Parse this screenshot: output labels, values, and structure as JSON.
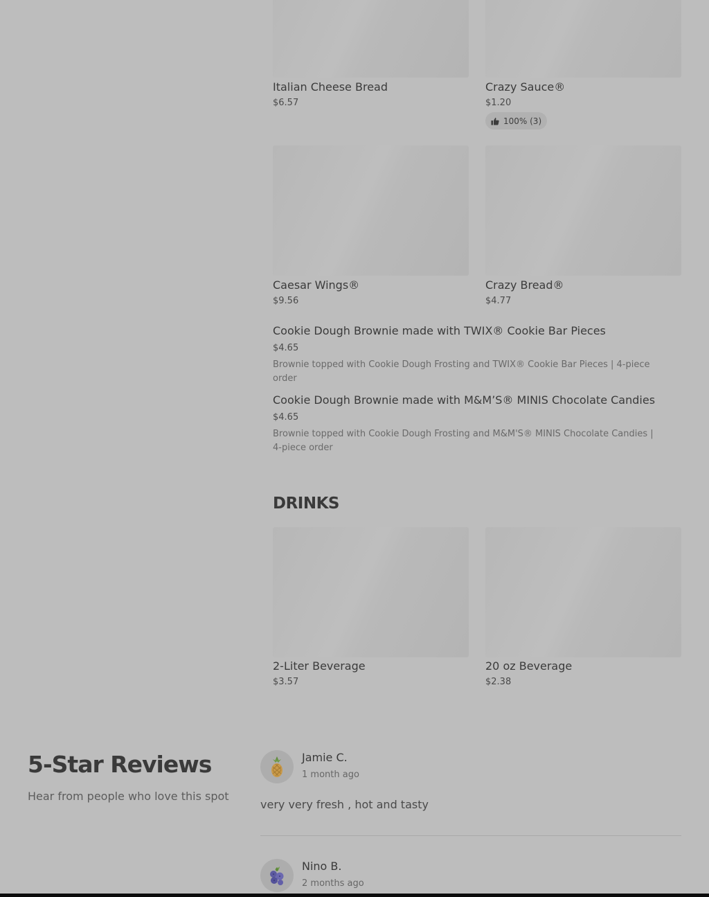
{
  "menu": {
    "items": [
      {
        "title": "Italian Cheese Bread",
        "price": "$6.57"
      },
      {
        "title": "Crazy Sauce®",
        "price": "$1.20",
        "rating": "100% (3)"
      },
      {
        "title": "Caesar Wings®",
        "price": "$9.56"
      },
      {
        "title": "Crazy Bread®",
        "price": "$4.77"
      }
    ],
    "text_items": [
      {
        "title": "Cookie Dough Brownie made with TWIX® Cookie Bar Pieces",
        "price": "$4.65",
        "description": "Brownie topped with Cookie Dough Frosting and TWIX® Cookie Bar Pieces | 4-piece order"
      },
      {
        "title": "Cookie Dough Brownie made with M&M’S® MINIS Chocolate Candies",
        "price": "$4.65",
        "description": "Brownie topped with Cookie Dough Frosting and M&M'S® MINIS Chocolate Candies | 4-piece order"
      }
    ],
    "drinks_heading": "DRINKS",
    "drinks": [
      {
        "title": "2-Liter Beverage",
        "price": "$3.57"
      },
      {
        "title": "20 oz Beverage",
        "price": "$2.38"
      }
    ]
  },
  "reviews": {
    "title": "5-Star Reviews",
    "subtitle": "Hear from people who love this spot",
    "list": [
      {
        "name": "Jamie C.",
        "date": "1 month ago",
        "text": "very very fresh , hot and tasty",
        "avatar_icon": "pineapple-icon"
      },
      {
        "name": "Nino B.",
        "date": "2 months ago",
        "avatar_icon": "blueberries-icon"
      }
    ]
  },
  "colors": {
    "overlay_background": "#bdbdbd",
    "text_primary": "#3a3a3a"
  }
}
